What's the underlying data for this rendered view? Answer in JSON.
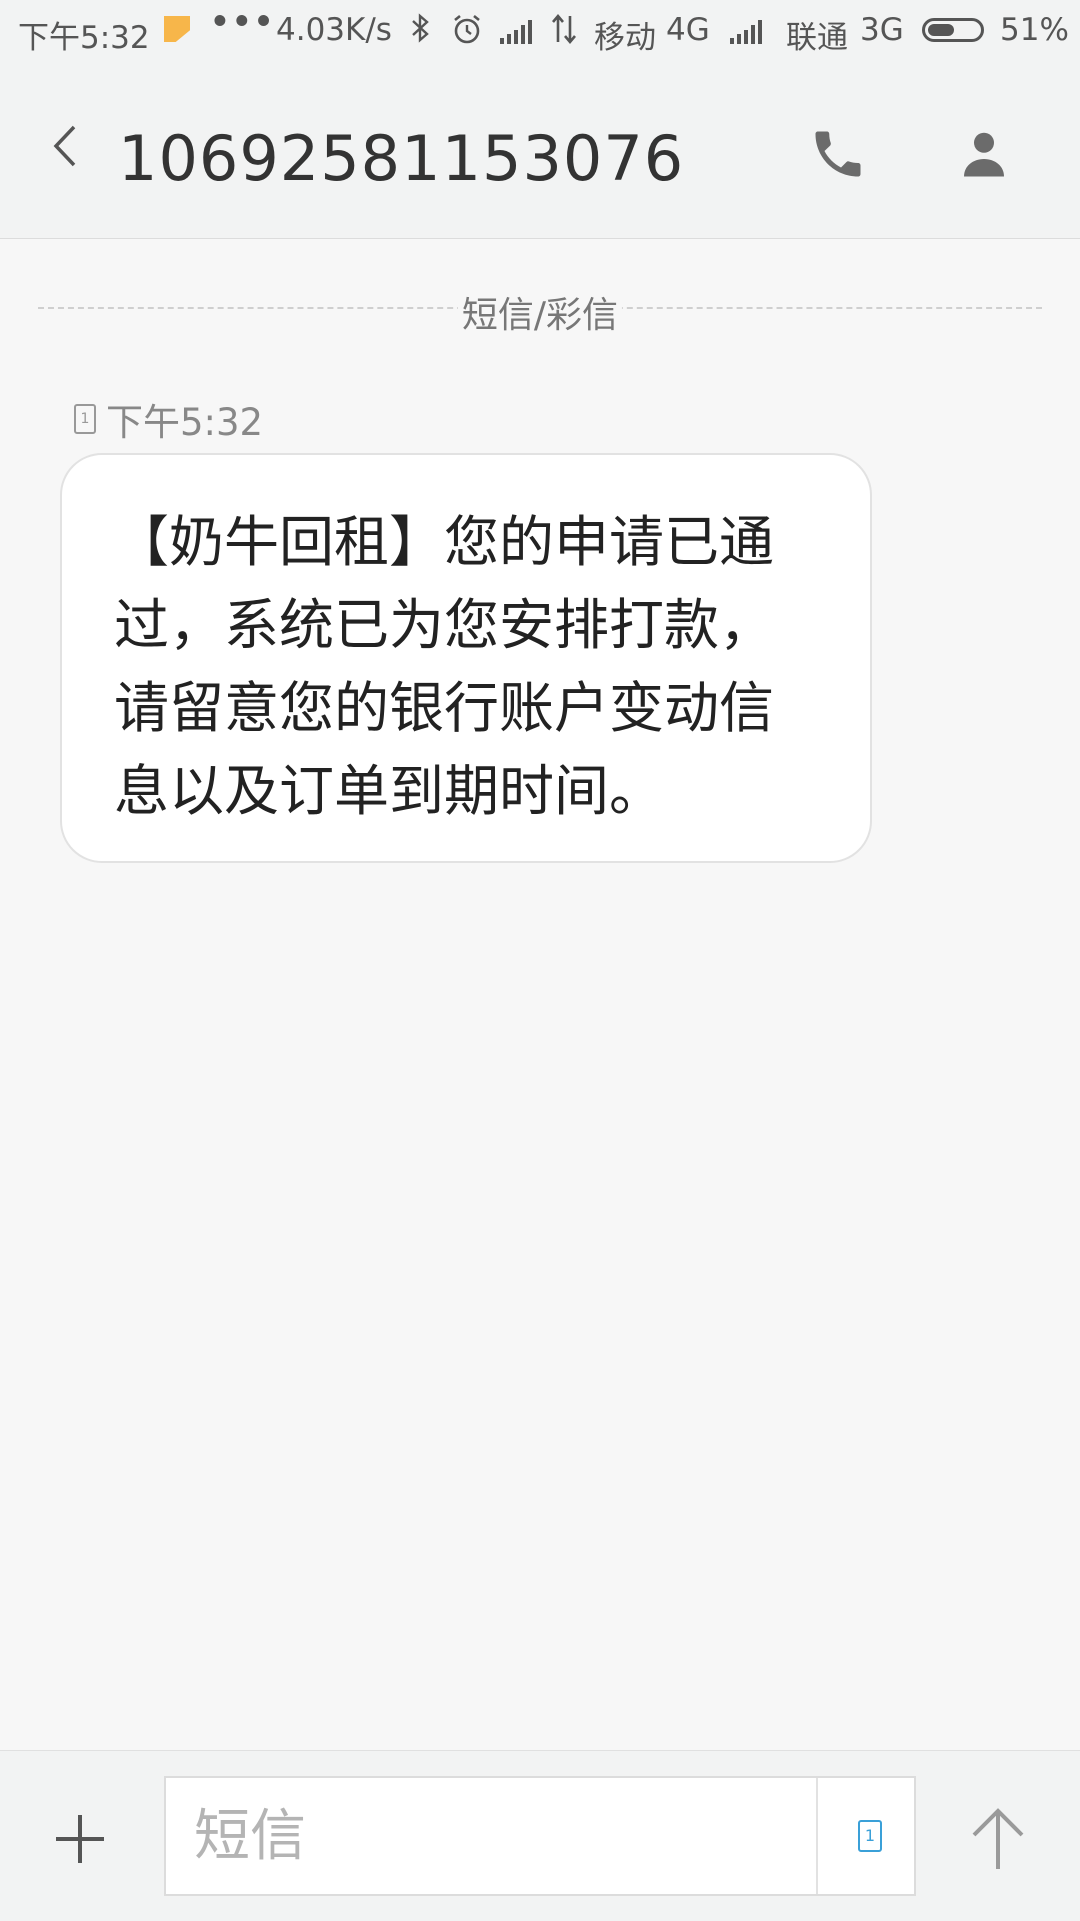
{
  "status_bar": {
    "time": "下午5:32",
    "dots": "•••",
    "net_speed": "4.03K/s",
    "carrier1": "移动",
    "carrier1_type": "4G",
    "carrier2": "联通",
    "carrier2_type": "3G",
    "battery_percent": "51%",
    "battery_level": 0.51
  },
  "header": {
    "title": "10692581153076"
  },
  "conversation": {
    "divider_label": "短信/彩信",
    "sim_slot": "1",
    "messages": [
      {
        "time": "下午5:32",
        "text": "【奶牛回租】您的申请已通过，系统已为您安排打款，请留意您的银行账户变动信息以及订单到期时间。"
      }
    ]
  },
  "compose": {
    "placeholder": "短信",
    "sim_slot": "1"
  },
  "icons": {
    "back": "chevron-left-icon",
    "call": "phone-icon",
    "profile": "person-icon",
    "add": "plus-icon",
    "send": "arrow-up-icon"
  },
  "colors": {
    "accent_sim": "#3aa0d8",
    "notify": "#f7b64a"
  }
}
